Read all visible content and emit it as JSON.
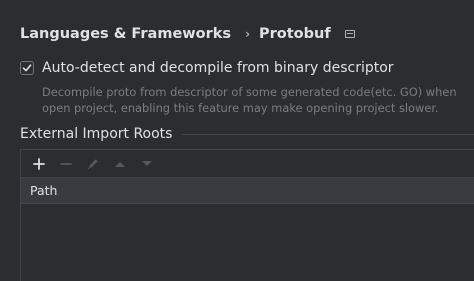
{
  "breadcrumb": {
    "parent": "Languages & Frameworks",
    "separator_icon": "chevron-right-icon",
    "current": "Protobuf",
    "window_icon": "window-icon"
  },
  "autodetect": {
    "label": "Auto-detect and decompile from binary descriptor",
    "checked": true,
    "hint_line1": "Decompile proto from descriptor of some generated code(etc. GO) when",
    "hint_line2": "open project, enabling this feature may make opening project slower."
  },
  "import_roots": {
    "title": "External Import Roots",
    "toolbar": {
      "add_icon": "plus-icon",
      "remove_icon": "minus-icon",
      "edit_icon": "pencil-icon",
      "move_up_icon": "triangle-up-icon",
      "move_down_icon": "triangle-down-icon"
    },
    "columns": [
      "Path"
    ],
    "rows": []
  },
  "colors": {
    "background": "#2b2d30",
    "text": "#dfe1e5",
    "hint_text": "#7a7e85",
    "table_header": "#393b40",
    "border": "#43454a"
  }
}
